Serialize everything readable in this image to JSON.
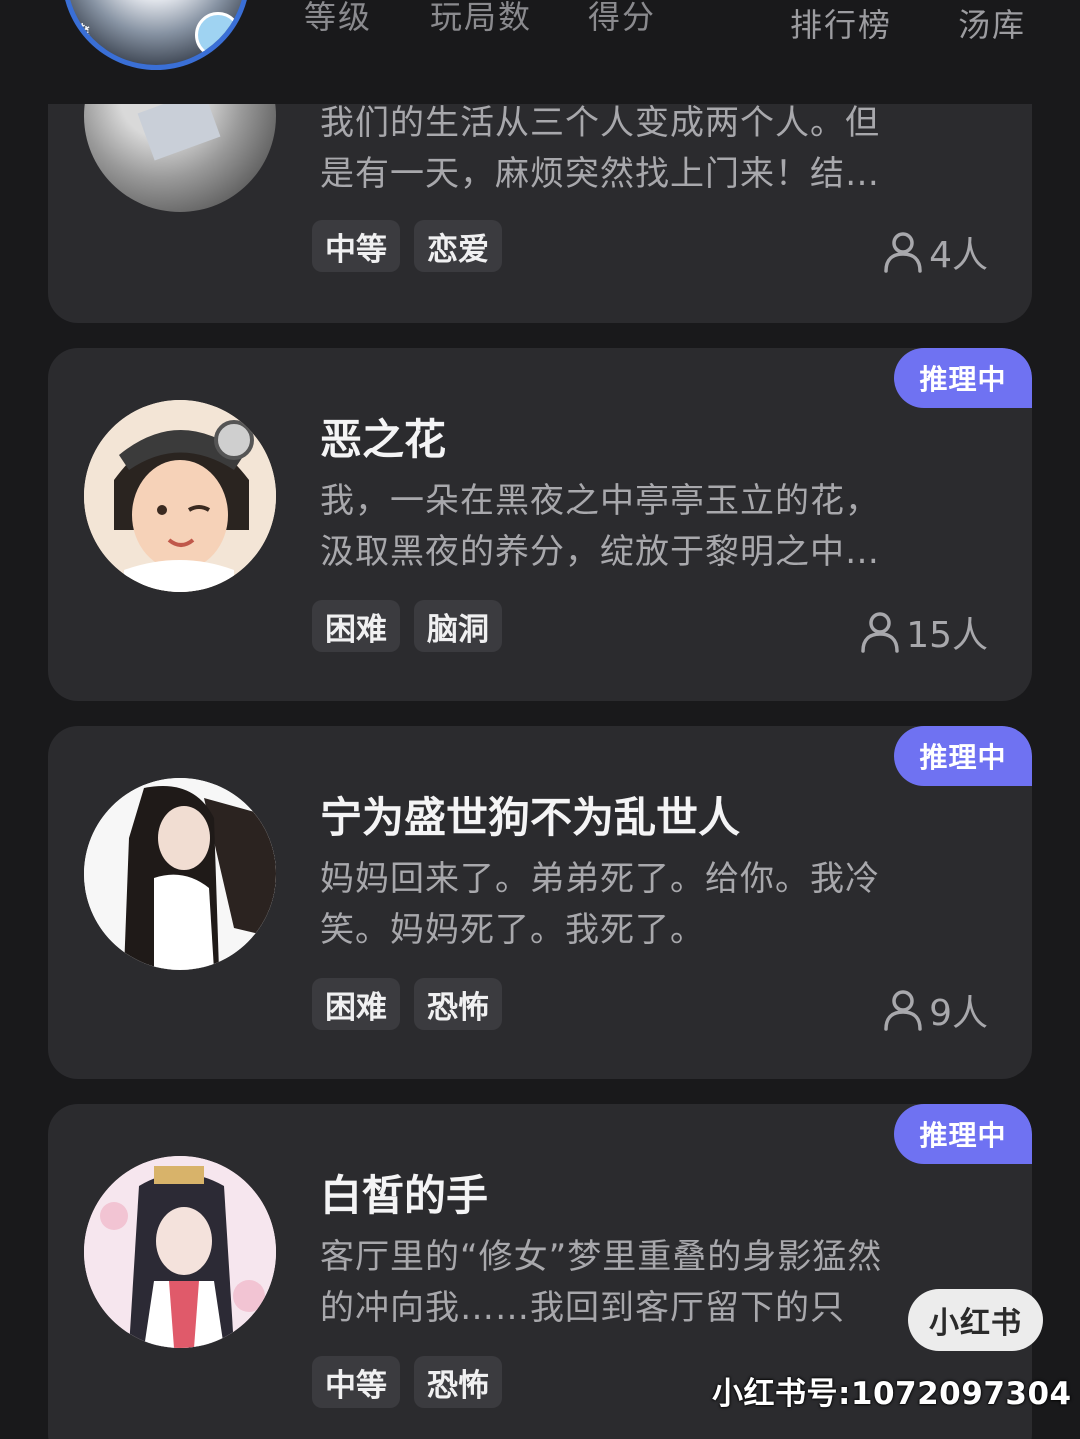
{
  "header": {
    "tabs": [
      "等级",
      "玩局数",
      "得分"
    ],
    "right_tabs": [
      "排行榜",
      "汤库"
    ]
  },
  "cards": [
    {
      "title": "",
      "desc_lines": [
        "我们的生活从三个人变成两个人。但",
        "是有一天，麻烦突然找上门来！结…"
      ],
      "tags": [
        "中等",
        "恋爱"
      ],
      "players": "4人",
      "status": ""
    },
    {
      "title": "恶之花",
      "desc_lines": [
        "我，一朵在黑夜之中亭亭玉立的花，",
        "汲取黑夜的养分，绽放于黎明之中…"
      ],
      "tags": [
        "困难",
        "脑洞"
      ],
      "players": "15人",
      "status": "推理中"
    },
    {
      "title": "宁为盛世狗不为乱世人",
      "desc_lines": [
        "妈妈回来了。弟弟死了。给你。我冷",
        "笑。妈妈死了。我死了。"
      ],
      "tags": [
        "困难",
        "恐怖"
      ],
      "players": "9人",
      "status": "推理中"
    },
    {
      "title": "白皙的手",
      "desc_lines": [
        "客厅里的“修女”梦里重叠的身影猛然",
        "的冲向我……我回到客厅留下的只"
      ],
      "tags": [
        "中等",
        "恐怖"
      ],
      "players": "",
      "status": "推理中"
    }
  ],
  "watermark": {
    "badge": "小红书",
    "id_text": "小红书号:1072097304"
  },
  "colors": {
    "background": "#19191b",
    "card": "#2b2b2e",
    "status_badge": "#6f72f2",
    "tag_bg": "#3b3b3f"
  },
  "icons": [
    "person-icon"
  ]
}
